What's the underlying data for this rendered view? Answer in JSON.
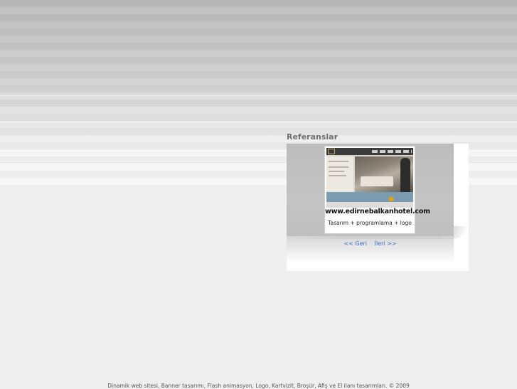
{
  "references": {
    "title": "Referanslar",
    "item": {
      "url": "www.edirnebalkanhotel.com",
      "description": "Tasarım + programlama + logo"
    },
    "prev_label": "<< Geri",
    "next_label": "İleri >>"
  },
  "footer": {
    "text": "Dinamik web sitesi, Banner tasarımı, Flash animasyon, Logo, Kartvizit, Broşür, Afiş ve El ilanı tasarımları. © 2009"
  }
}
